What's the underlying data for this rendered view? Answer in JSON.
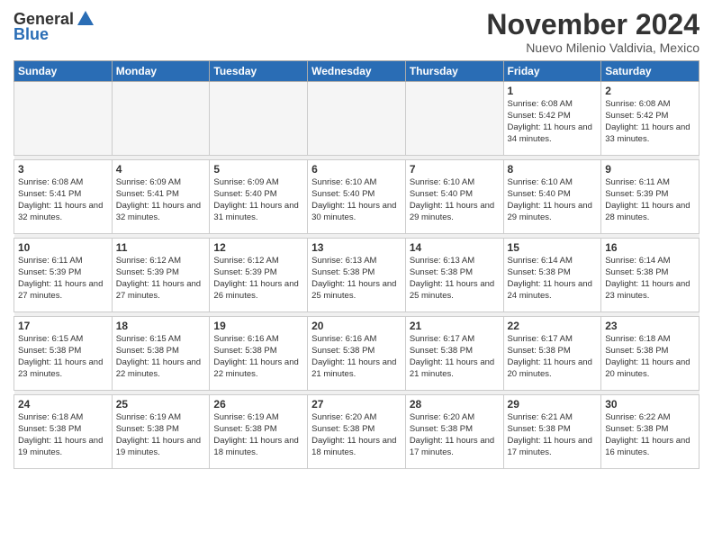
{
  "header": {
    "logo_general": "General",
    "logo_blue": "Blue",
    "month": "November 2024",
    "location": "Nuevo Milenio Valdivia, Mexico"
  },
  "weekdays": [
    "Sunday",
    "Monday",
    "Tuesday",
    "Wednesday",
    "Thursday",
    "Friday",
    "Saturday"
  ],
  "weeks": [
    [
      {
        "day": "",
        "info": ""
      },
      {
        "day": "",
        "info": ""
      },
      {
        "day": "",
        "info": ""
      },
      {
        "day": "",
        "info": ""
      },
      {
        "day": "",
        "info": ""
      },
      {
        "day": "1",
        "info": "Sunrise: 6:08 AM\nSunset: 5:42 PM\nDaylight: 11 hours and 34 minutes."
      },
      {
        "day": "2",
        "info": "Sunrise: 6:08 AM\nSunset: 5:42 PM\nDaylight: 11 hours and 33 minutes."
      }
    ],
    [
      {
        "day": "3",
        "info": "Sunrise: 6:08 AM\nSunset: 5:41 PM\nDaylight: 11 hours and 32 minutes."
      },
      {
        "day": "4",
        "info": "Sunrise: 6:09 AM\nSunset: 5:41 PM\nDaylight: 11 hours and 32 minutes."
      },
      {
        "day": "5",
        "info": "Sunrise: 6:09 AM\nSunset: 5:40 PM\nDaylight: 11 hours and 31 minutes."
      },
      {
        "day": "6",
        "info": "Sunrise: 6:10 AM\nSunset: 5:40 PM\nDaylight: 11 hours and 30 minutes."
      },
      {
        "day": "7",
        "info": "Sunrise: 6:10 AM\nSunset: 5:40 PM\nDaylight: 11 hours and 29 minutes."
      },
      {
        "day": "8",
        "info": "Sunrise: 6:10 AM\nSunset: 5:40 PM\nDaylight: 11 hours and 29 minutes."
      },
      {
        "day": "9",
        "info": "Sunrise: 6:11 AM\nSunset: 5:39 PM\nDaylight: 11 hours and 28 minutes."
      }
    ],
    [
      {
        "day": "10",
        "info": "Sunrise: 6:11 AM\nSunset: 5:39 PM\nDaylight: 11 hours and 27 minutes."
      },
      {
        "day": "11",
        "info": "Sunrise: 6:12 AM\nSunset: 5:39 PM\nDaylight: 11 hours and 27 minutes."
      },
      {
        "day": "12",
        "info": "Sunrise: 6:12 AM\nSunset: 5:39 PM\nDaylight: 11 hours and 26 minutes."
      },
      {
        "day": "13",
        "info": "Sunrise: 6:13 AM\nSunset: 5:38 PM\nDaylight: 11 hours and 25 minutes."
      },
      {
        "day": "14",
        "info": "Sunrise: 6:13 AM\nSunset: 5:38 PM\nDaylight: 11 hours and 25 minutes."
      },
      {
        "day": "15",
        "info": "Sunrise: 6:14 AM\nSunset: 5:38 PM\nDaylight: 11 hours and 24 minutes."
      },
      {
        "day": "16",
        "info": "Sunrise: 6:14 AM\nSunset: 5:38 PM\nDaylight: 11 hours and 23 minutes."
      }
    ],
    [
      {
        "day": "17",
        "info": "Sunrise: 6:15 AM\nSunset: 5:38 PM\nDaylight: 11 hours and 23 minutes."
      },
      {
        "day": "18",
        "info": "Sunrise: 6:15 AM\nSunset: 5:38 PM\nDaylight: 11 hours and 22 minutes."
      },
      {
        "day": "19",
        "info": "Sunrise: 6:16 AM\nSunset: 5:38 PM\nDaylight: 11 hours and 22 minutes."
      },
      {
        "day": "20",
        "info": "Sunrise: 6:16 AM\nSunset: 5:38 PM\nDaylight: 11 hours and 21 minutes."
      },
      {
        "day": "21",
        "info": "Sunrise: 6:17 AM\nSunset: 5:38 PM\nDaylight: 11 hours and 21 minutes."
      },
      {
        "day": "22",
        "info": "Sunrise: 6:17 AM\nSunset: 5:38 PM\nDaylight: 11 hours and 20 minutes."
      },
      {
        "day": "23",
        "info": "Sunrise: 6:18 AM\nSunset: 5:38 PM\nDaylight: 11 hours and 20 minutes."
      }
    ],
    [
      {
        "day": "24",
        "info": "Sunrise: 6:18 AM\nSunset: 5:38 PM\nDaylight: 11 hours and 19 minutes."
      },
      {
        "day": "25",
        "info": "Sunrise: 6:19 AM\nSunset: 5:38 PM\nDaylight: 11 hours and 19 minutes."
      },
      {
        "day": "26",
        "info": "Sunrise: 6:19 AM\nSunset: 5:38 PM\nDaylight: 11 hours and 18 minutes."
      },
      {
        "day": "27",
        "info": "Sunrise: 6:20 AM\nSunset: 5:38 PM\nDaylight: 11 hours and 18 minutes."
      },
      {
        "day": "28",
        "info": "Sunrise: 6:20 AM\nSunset: 5:38 PM\nDaylight: 11 hours and 17 minutes."
      },
      {
        "day": "29",
        "info": "Sunrise: 6:21 AM\nSunset: 5:38 PM\nDaylight: 11 hours and 17 minutes."
      },
      {
        "day": "30",
        "info": "Sunrise: 6:22 AM\nSunset: 5:38 PM\nDaylight: 11 hours and 16 minutes."
      }
    ]
  ]
}
